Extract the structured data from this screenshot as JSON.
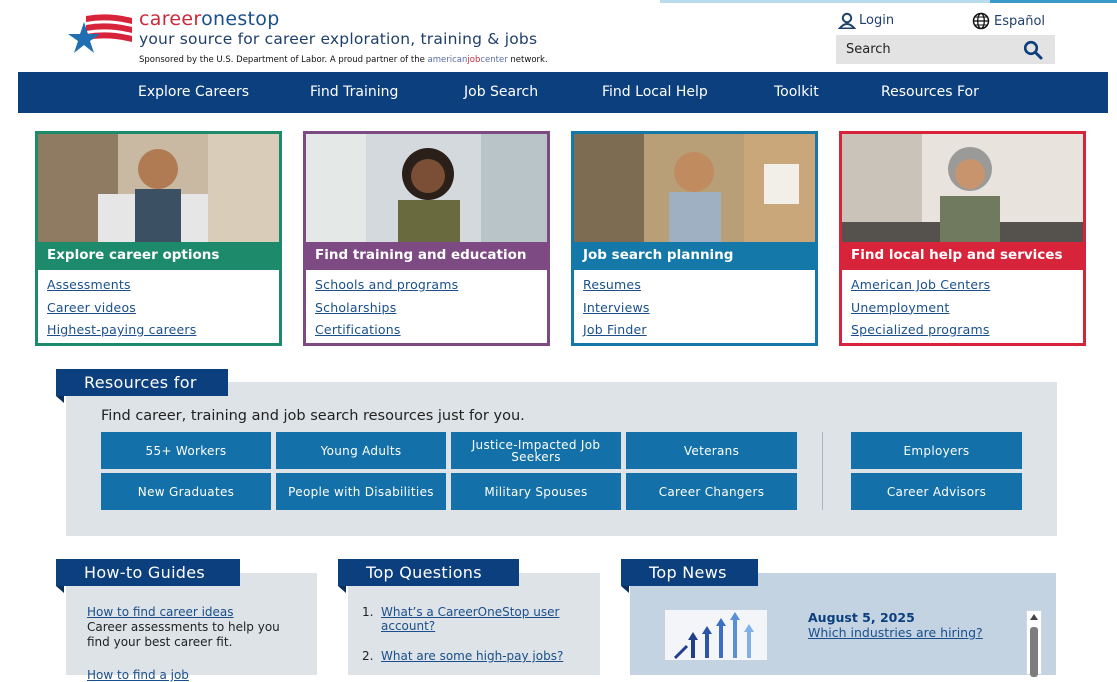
{
  "header": {
    "brand_part1": "career",
    "brand_part2": "onestop",
    "tagline": "your source for career exploration, training & jobs",
    "sponsor_text": "Sponsored by the U.S. Department of Labor. A proud partner of the",
    "ajc_part1": "american",
    "ajc_part2": "job",
    "ajc_part3": "center",
    "sponsor_suffix": "network.",
    "login_label": "Login",
    "language_label": "Español",
    "search_placeholder": "Search"
  },
  "nav": {
    "items": [
      "Explore Careers",
      "Find Training",
      "Job Search",
      "Find Local Help",
      "Toolkit",
      "Resources For"
    ]
  },
  "cards": [
    {
      "title": "Explore career options",
      "color": "#1e8a6c",
      "links": [
        "Assessments",
        "Career videos",
        "Highest-paying careers"
      ]
    },
    {
      "title": "Find training and education",
      "color": "#7d4a84",
      "links": [
        "Schools and programs",
        "Scholarships",
        "Certifications"
      ]
    },
    {
      "title": "Job search planning",
      "color": "#1478a8",
      "links": [
        "Resumes",
        "Interviews",
        "Job Finder"
      ]
    },
    {
      "title": "Find local help and services",
      "color": "#d8243b",
      "links": [
        "American Job Centers",
        "Unemployment",
        "Specialized programs"
      ]
    }
  ],
  "resources": {
    "heading": "Resources for",
    "intro": "Find career, training and job search resources just for you.",
    "buttons_row1": [
      "55+ Workers",
      "Young Adults",
      "Justice-Impacted Job Seekers",
      "Veterans"
    ],
    "buttons_row2": [
      "New Graduates",
      "People with Disabilities",
      "Military Spouses",
      "Career Changers"
    ],
    "buttons_side": [
      "Employers",
      "Career Advisors"
    ]
  },
  "howto": {
    "heading": "How-to Guides",
    "link1": "How to find career ideas",
    "desc1": "Career assessments to help you find your best career fit.",
    "link2": "How to find a job"
  },
  "questions": {
    "heading": "Top Questions",
    "items": [
      {
        "num": "1.",
        "text": "What’s a CareerOneStop user account?"
      },
      {
        "num": "2.",
        "text": "What are some high-pay jobs?"
      }
    ]
  },
  "news": {
    "heading": "Top News",
    "date": "August 5, 2025",
    "link": "Which industries are hiring?"
  },
  "colors": {
    "nav_bg": "#0c3f7e",
    "button_bg": "#1370a8",
    "brand_red": "#cc2a3a"
  }
}
